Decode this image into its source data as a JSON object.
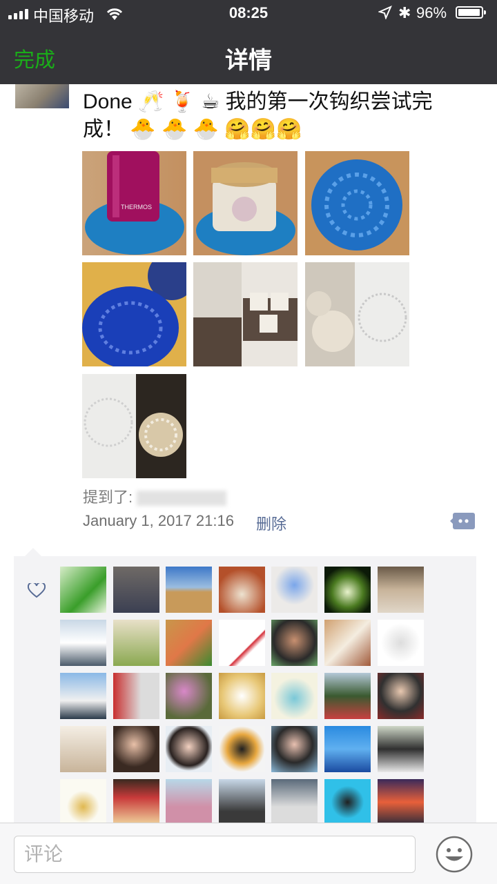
{
  "status": {
    "carrier": "中国移动",
    "time": "08:25",
    "battery": "96%",
    "battery_level": 0.96
  },
  "nav": {
    "back_label": "完成",
    "title": "详情"
  },
  "post": {
    "text": "Done 🥂 🍹 ☕ 我的第一次钩织尝试完成！ 🐣 🐣 🐣 🤗🤗🤗",
    "photos": [
      {
        "name": "photo-thermos-coaster"
      },
      {
        "name": "photo-jar-coaster"
      },
      {
        "name": "photo-blue-doily"
      },
      {
        "name": "photo-blue-doily-yarn"
      },
      {
        "name": "photo-book-page-1"
      },
      {
        "name": "photo-book-page-2"
      },
      {
        "name": "photo-book-page-3"
      }
    ],
    "mentions_label": "提到了:",
    "timestamp": "January 1, 2017 21:16",
    "delete_label": "删除"
  },
  "likes": {
    "icon": "heart-icon",
    "avatar_count_rows": 5
  },
  "comment_bar": {
    "placeholder": "评论",
    "emoji_icon": "smiley-icon"
  }
}
